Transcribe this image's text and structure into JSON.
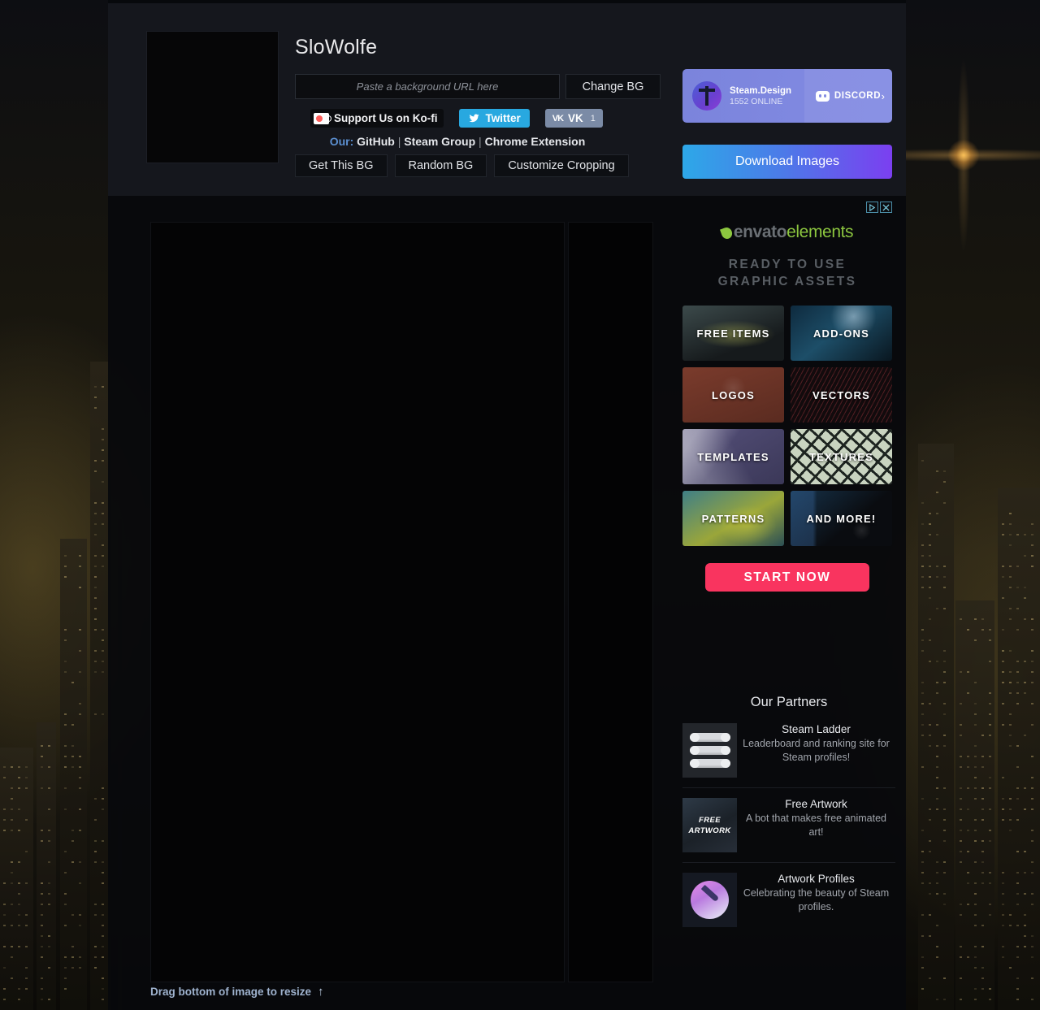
{
  "profile": {
    "username": "SloWolfe",
    "avatar_name": "user-avatar"
  },
  "background_form": {
    "url_value": "",
    "url_placeholder": "Paste a background URL here",
    "change_button": "Change BG"
  },
  "social": {
    "kofi": "Support Us on Ko-fi",
    "twitter": "Twitter",
    "vk": "VK",
    "vk_count": "1"
  },
  "our_links": {
    "label": "Our:",
    "separator": "|",
    "items": [
      {
        "label": "GitHub"
      },
      {
        "label": "Steam Group"
      },
      {
        "label": "Chrome Extension"
      }
    ]
  },
  "bg_actions": [
    {
      "label": "Get This BG"
    },
    {
      "label": "Random BG"
    },
    {
      "label": "Customize Cropping"
    }
  ],
  "preview": {
    "resize_hint": "Drag bottom of image to resize",
    "resize_arrow": "↑"
  },
  "discord_banner": {
    "server_name": "Steam.Design",
    "online": "1552 ONLINE",
    "discord_word": "DISCORD",
    "chevron": "›"
  },
  "download": {
    "label": "Download Images"
  },
  "ad": {
    "brand_part1": "envato",
    "brand_part2": "elements",
    "headline_line1": "READY TO USE",
    "headline_line2": "GRAPHIC ASSETS",
    "tiles": [
      {
        "label": "FREE ITEMS",
        "theme": "t-free"
      },
      {
        "label": "ADD-ONS",
        "theme": "t-addons"
      },
      {
        "label": "LOGOS",
        "theme": "t-logos"
      },
      {
        "label": "VECTORS",
        "theme": "t-vectors"
      },
      {
        "label": "TEMPLATES",
        "theme": "t-templates"
      },
      {
        "label": "TEXTURES",
        "theme": "t-textures"
      },
      {
        "label": "PATTERNS",
        "theme": "t-patterns"
      },
      {
        "label": "AND MORE!",
        "theme": "t-more"
      }
    ],
    "cta": "START NOW"
  },
  "partners": {
    "title": "Our Partners",
    "items": [
      {
        "name": "Steam Ladder",
        "desc": "Leaderboard and ranking site for Steam profiles!",
        "icon": "ladder-icon"
      },
      {
        "name": "Free Artwork",
        "desc": "A bot that makes free animated art!",
        "icon_text_line1": "FREE",
        "icon_text_line2": "ARTWORK",
        "icon": "free-artwork-icon"
      },
      {
        "name": "Artwork Profiles",
        "desc": "Celebrating the beauty of Steam profiles.",
        "icon": "paintbrush-icon"
      }
    ]
  },
  "colors": {
    "accent_blue": "#5b8fd0",
    "twitter": "#28a8e0",
    "vk": "#7b8ba6",
    "discord_banner": "#7f88e0",
    "download_start": "#2da8e8",
    "download_end": "#7b3ff0",
    "cta_pink": "#f9345f",
    "envato_green": "#8cc63f"
  }
}
